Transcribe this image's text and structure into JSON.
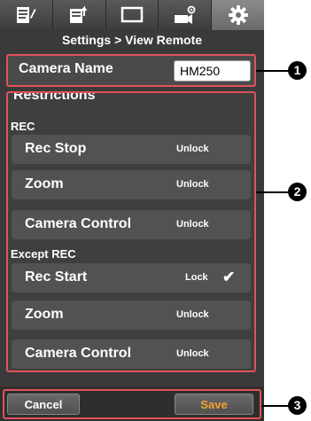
{
  "tabs": [
    {
      "icon": "edit-list-icon",
      "active": false
    },
    {
      "icon": "upload-list-icon",
      "active": false
    },
    {
      "icon": "monitor-icon",
      "active": false
    },
    {
      "icon": "camera-settings-icon",
      "active": false
    },
    {
      "icon": "gear-icon",
      "active": true
    }
  ],
  "header": {
    "title": "Settings > View Remote"
  },
  "camera": {
    "label": "Camera Name",
    "value": "HM250"
  },
  "restrictions": {
    "title": "Restrictions",
    "sections": [
      {
        "label": "REC",
        "rows": [
          {
            "label": "Rec Stop",
            "state": "Unlock",
            "checked": false
          },
          {
            "label": "Zoom",
            "state": "Unlock",
            "checked": false
          },
          {
            "label": "Camera Control",
            "state": "Unlock",
            "checked": false
          }
        ]
      },
      {
        "label": "Except REC",
        "rows": [
          {
            "label": "Rec Start",
            "state": "Lock",
            "checked": true
          },
          {
            "label": "Zoom",
            "state": "Unlock",
            "checked": false
          },
          {
            "label": "Camera Control",
            "state": "Unlock",
            "checked": false
          }
        ]
      }
    ],
    "check_glyph": "✔"
  },
  "buttons": {
    "cancel": "Cancel",
    "save": "Save",
    "save_color": "#f0a030"
  },
  "callouts": [
    "1",
    "2",
    "3"
  ],
  "colors": {
    "highlight": "#e0525c",
    "background": "#3a3a3a"
  }
}
